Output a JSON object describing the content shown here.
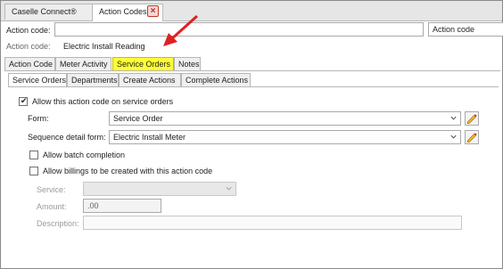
{
  "doc_tabs": [
    {
      "label": "Caselle Connect®"
    },
    {
      "label": "Action Codes"
    }
  ],
  "search": {
    "label": "Action code:",
    "value": "",
    "field": "Action code"
  },
  "record": {
    "label": "Action code:",
    "value": "Electric Install Reading"
  },
  "main_tabs": [
    {
      "label": "Action Code"
    },
    {
      "label": "Meter Activity"
    },
    {
      "label": "Service Orders",
      "active": true,
      "highlighted": true
    },
    {
      "label": "Notes"
    }
  ],
  "sub_tabs": [
    {
      "label": "Service Orders",
      "active": true
    },
    {
      "label": "Departments"
    },
    {
      "label": "Create Actions"
    },
    {
      "label": "Complete Actions"
    }
  ],
  "allow_service_orders": {
    "label": "Allow this action code on service orders",
    "checked": true
  },
  "form": {
    "label": "Form:",
    "value": "Service Order"
  },
  "sequence_detail": {
    "label": "Sequence detail form:",
    "value": "Electric Install Meter"
  },
  "allow_batch": {
    "label": "Allow batch completion",
    "checked": false
  },
  "allow_billings": {
    "label": "Allow billings to be created with this action code",
    "checked": false
  },
  "service": {
    "label": "Service:",
    "value": ""
  },
  "amount": {
    "label": "Amount:",
    "value": ".00"
  },
  "description": {
    "label": "Description:",
    "value": ""
  },
  "colors": {
    "highlight": "#ffff33",
    "arrow": "#e02020",
    "close": "#c0392b"
  }
}
